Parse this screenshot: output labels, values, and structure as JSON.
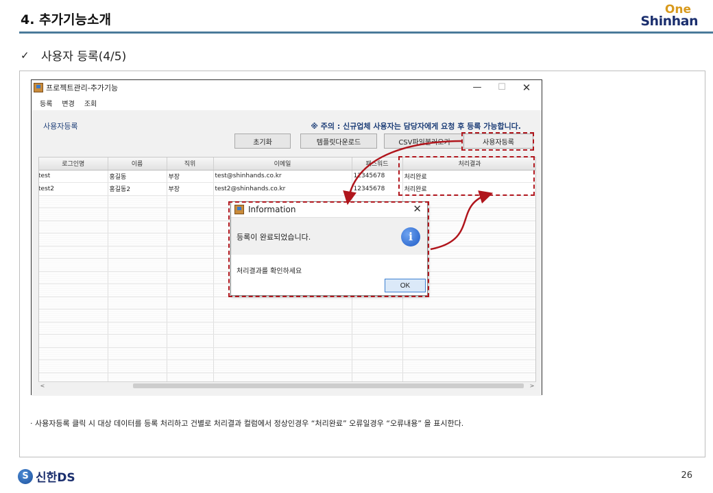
{
  "slide": {
    "title": "4. 추가기능소개",
    "subtitle": "사용자 등록(4/5)",
    "brand_top": "One",
    "brand_bottom": "Shinhan",
    "footnote": "· 사용자등록 클릭 시 대상 데이터를 등록 처리하고 건별로 처리결과 컬럼에서 정상인경우 “처리완료” 오류일경우 “오류내용” 을 표시한다.",
    "footer_logo": "신한DS",
    "footer_logo_icon_text": "S",
    "page_number": "26"
  },
  "window": {
    "title": "프로젝트관리-추가기능",
    "controls": {
      "minimize": "—",
      "maximize": "☐",
      "close": "✕"
    },
    "menu": [
      "등록",
      "변경",
      "조회"
    ],
    "section_title": "사용자등록",
    "notice": "※ 주의 : 신규업체 사용자는 담당자에게 요청 후 등록 가능합니다.",
    "buttons": {
      "reset": "초기화",
      "template": "템플릿다운로드",
      "csv": "CSV파일불러오기",
      "register": "사용자등록"
    },
    "table": {
      "columns": [
        "로그인명",
        "이름",
        "직위",
        "이메일",
        "패스워드",
        "처리결과"
      ],
      "rows": [
        [
          "test",
          "홍길동",
          "부장",
          "test@shinhands.co.kr",
          "12345678",
          "처리완료"
        ],
        [
          "test2",
          "홍길동2",
          "부장",
          "test2@shinhands.co.kr",
          "12345678",
          "처리완료"
        ]
      ]
    },
    "scroll_left": "<",
    "scroll_right": ">"
  },
  "dialog": {
    "title": "Information",
    "close": "✕",
    "message": "등록이 완료되었습니다.",
    "icon": "info-icon",
    "icon_text": "i",
    "detail": "처리결과를 확인하세요",
    "ok_label": "OK"
  },
  "colors": {
    "callout": "#b0151c",
    "title_rule": "#4a7a9a",
    "notice": "#1e3f78",
    "brand_navy": "#1b2f6e",
    "brand_gold": "#d89a1e"
  }
}
